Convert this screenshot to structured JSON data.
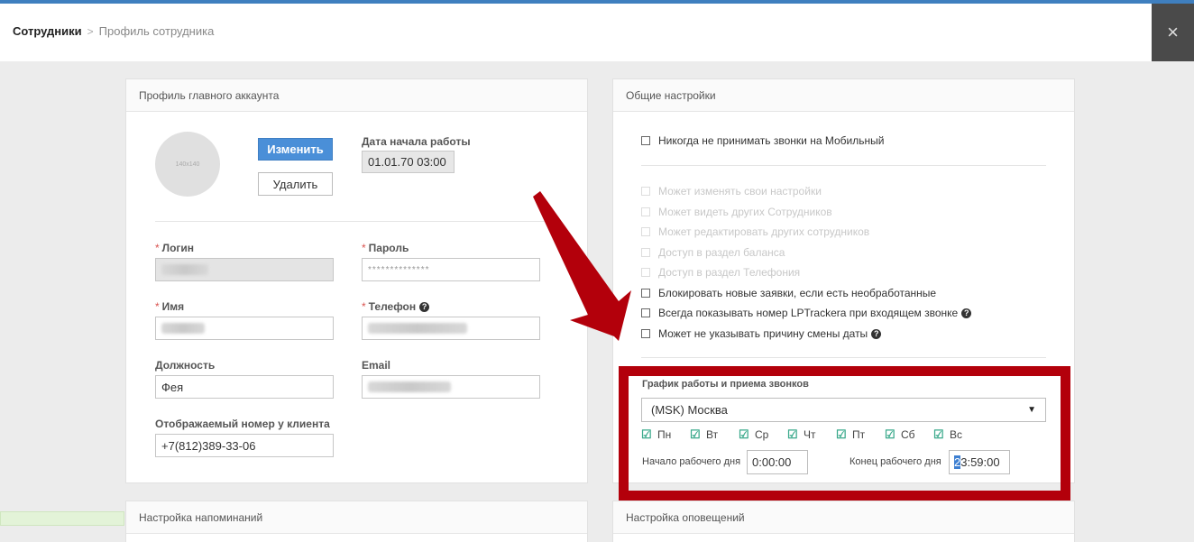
{
  "breadcrumb": {
    "root": "Сотрудники",
    "separator": ">",
    "current": "Профиль сотрудника"
  },
  "close_icon": "×",
  "profile": {
    "title": "Профиль главного аккаунта",
    "avatar_text": "140x140",
    "change_button": "Изменить",
    "delete_button": "Удалить",
    "start_date_label": "Дата начала работы",
    "start_date_value": "01.01.70 03:00",
    "login_label": "Логин",
    "password_label": "Пароль",
    "password_value": "**************",
    "name_label": "Имя",
    "phone_label": "Телефон",
    "position_label": "Должность",
    "position_value": "Фея",
    "email_label": "Email",
    "display_number_label": "Отображаемый номер у клиента",
    "display_number_value": "+7(812)389-33-06",
    "required_mark": "*"
  },
  "settings": {
    "title": "Общие настройки",
    "options": [
      {
        "label": "Никогда не принимать звонки на Мобильный",
        "enabled": true
      },
      {
        "label": "Может изменять свои настройки",
        "enabled": false
      },
      {
        "label": "Может видеть других Сотрудников",
        "enabled": false
      },
      {
        "label": "Может редактировать других сотрудников",
        "enabled": false
      },
      {
        "label": "Доступ в раздел баланса",
        "enabled": false
      },
      {
        "label": "Доступ в раздел Телефония",
        "enabled": false
      },
      {
        "label": "Блокировать новые заявки, если есть необработанные",
        "enabled": true
      },
      {
        "label": "Всегда показывать номер LPTrackera при входящем звонке",
        "enabled": true
      },
      {
        "label": "Может не указывать причину смены даты",
        "enabled": true
      }
    ],
    "schedule": {
      "label": "График работы и приема звонков",
      "timezone": "(MSK) Москва",
      "days": [
        "Пн",
        "Вт",
        "Ср",
        "Чт",
        "Пт",
        "Сб",
        "Вс"
      ],
      "start_label": "Начало рабочего дня",
      "start_value": "0:00:00",
      "end_label": "Конец рабочего дня",
      "end_value_first": "2",
      "end_value_rest": "3:59:00"
    }
  },
  "reminders": {
    "title": "Настройка напоминаний"
  },
  "notifications": {
    "title": "Настройка оповещений"
  },
  "colors": {
    "accent": "#4a8fd8",
    "highlight": "#b3000b",
    "check": "#3aa98b"
  }
}
